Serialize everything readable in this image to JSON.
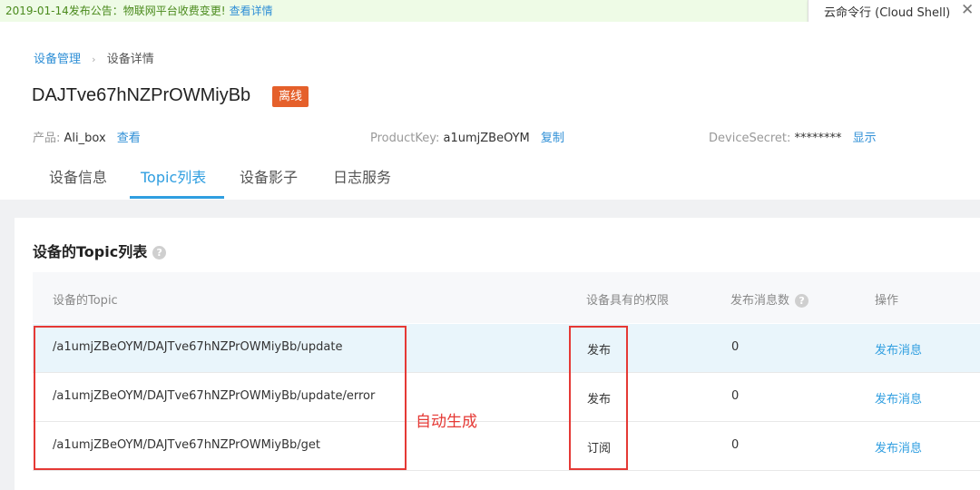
{
  "notice": {
    "text": "2019-01-14发布公告：物联网平台收费变更!",
    "link": "查看详情"
  },
  "cloudshell": {
    "label": "云命令行 (Cloud Shell)",
    "close_icon": "close-icon"
  },
  "breadcrumb": {
    "parent": "设备管理",
    "separator": "›",
    "current": "设备详情"
  },
  "device": {
    "name": "DAJTve67hNZPrOWMiyBb",
    "status": "离线",
    "product_label": "产品:",
    "product_value": "Ali_box",
    "product_link": "查看",
    "productkey_label": "ProductKey:",
    "productkey_value": "a1umjZBeOYM",
    "productkey_link": "复制",
    "secret_label": "DeviceSecret:",
    "secret_value": "********",
    "secret_link": "显示"
  },
  "tabs": [
    {
      "label": "设备信息",
      "active": false
    },
    {
      "label": "Topic列表",
      "active": true
    },
    {
      "label": "设备影子",
      "active": false
    },
    {
      "label": "日志服务",
      "active": false
    }
  ],
  "card": {
    "title": "设备的Topic列表",
    "help_icon": "help-icon"
  },
  "table": {
    "headers": [
      "设备的Topic",
      "设备具有的权限",
      "发布消息数",
      "操作"
    ],
    "count_help_icon": "help-icon",
    "rows": [
      {
        "topic": "/a1umjZBeOYM/DAJTve67hNZPrOWMiyBb/update",
        "permission": "发布",
        "count": "0",
        "action": "发布消息"
      },
      {
        "topic": "/a1umjZBeOYM/DAJTve67hNZPrOWMiyBb/update/error",
        "permission": "发布",
        "count": "0",
        "action": "发布消息"
      },
      {
        "topic": "/a1umjZBeOYM/DAJTve67hNZPrOWMiyBb/get",
        "permission": "订阅",
        "count": "0",
        "action": "发布消息"
      }
    ]
  },
  "annotation": {
    "text": "自动生成",
    "color": "#e53935"
  },
  "colors": {
    "accent": "#2f9ee0",
    "offline_badge": "#e5602b",
    "notice_bg": "#eefbe6"
  }
}
